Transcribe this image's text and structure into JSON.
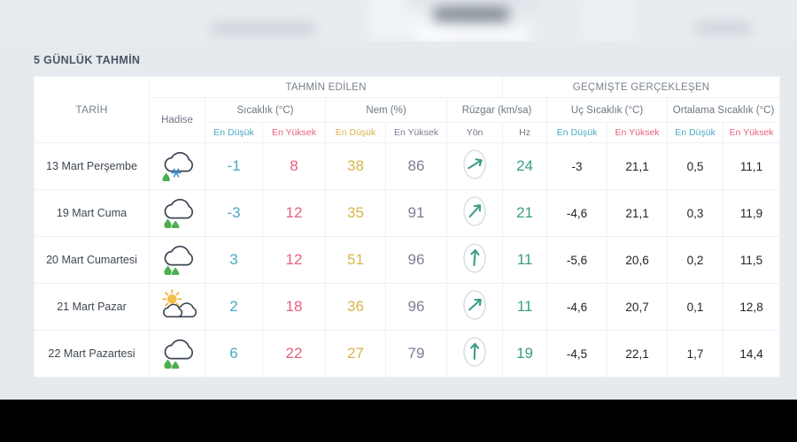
{
  "panel": {
    "title": "5 GÜNLÜK TAHMİN"
  },
  "colors": {
    "temp_low": "#49a9c4",
    "temp_high": "#e8607f",
    "humidity_low": "#d7b54a",
    "humidity_high": "#7a7f96",
    "wind_speed": "#3a9d88",
    "historic": "#1f2328",
    "page_bg": "#e6eaee",
    "table_bg": "#ffffff",
    "border": "#eef2f5",
    "title": "#4a5664"
  },
  "table": {
    "groups": {
      "date": "TARİH",
      "forecast": "TAHMİN EDİLEN",
      "historic": "GEÇMİŞTE GERÇEKLEŞEN"
    },
    "subgroups": {
      "event": "Hadise",
      "temperature": "Sıcaklık (°C)",
      "humidity": "Nem (%)",
      "wind": "Rüzgar (km/sa)",
      "extreme_temp": "Uç Sıcaklık (°C)",
      "average_temp": "Ortalama Sıcaklık (°C)"
    },
    "labels": {
      "temp_low": "En Düşük",
      "temp_high": "En Yüksek",
      "hum_low": "En Düşük",
      "hum_high": "En Yüksek",
      "wind_dir": "Yön",
      "wind_speed": "Hz",
      "ext_low": "En Düşük",
      "ext_high": "En Yüksek",
      "avg_low": "En Düşük",
      "avg_high": "En Yüksek"
    },
    "rows": [
      {
        "date": "13 Mart Perşembe",
        "icon": "cloud-rain-snow-icon",
        "temp_low": "-1",
        "temp_high": "8",
        "hum_low": "38",
        "hum_high": "86",
        "wind_dir_icon": "arrow-northeast-icon",
        "wind_dir_deg": 58,
        "wind_speed": "24",
        "ext_low": "-3",
        "ext_high": "21,1",
        "avg_low": "0,5",
        "avg_high": "11,1"
      },
      {
        "date": "19 Mart Cuma",
        "icon": "cloud-rain-icon",
        "temp_low": "-3",
        "temp_high": "12",
        "hum_low": "35",
        "hum_high": "91",
        "wind_dir_icon": "arrow-northeast-icon",
        "wind_dir_deg": 42,
        "wind_speed": "21",
        "ext_low": "-4,6",
        "ext_high": "21,1",
        "avg_low": "0,3",
        "avg_high": "11,9"
      },
      {
        "date": "20 Mart Cumartesi",
        "icon": "cloud-rain-icon",
        "temp_low": "3",
        "temp_high": "12",
        "hum_low": "51",
        "hum_high": "96",
        "wind_dir_icon": "arrow-north-icon",
        "wind_dir_deg": 5,
        "wind_speed": "11",
        "ext_low": "-5,6",
        "ext_high": "20,6",
        "avg_low": "0,2",
        "avg_high": "11,5"
      },
      {
        "date": "21 Mart Pazar",
        "icon": "sun-cloud-icon",
        "temp_low": "2",
        "temp_high": "18",
        "hum_low": "36",
        "hum_high": "96",
        "wind_dir_icon": "arrow-northeast-icon",
        "wind_dir_deg": 48,
        "wind_speed": "11",
        "ext_low": "-4,6",
        "ext_high": "20,7",
        "avg_low": "0,1",
        "avg_high": "12,8"
      },
      {
        "date": "22 Mart Pazartesi",
        "icon": "cloud-rain-icon",
        "temp_low": "6",
        "temp_high": "22",
        "hum_low": "27",
        "hum_high": "79",
        "wind_dir_icon": "arrow-north-icon",
        "wind_dir_deg": 2,
        "wind_speed": "19",
        "ext_low": "-4,5",
        "ext_high": "22,1",
        "avg_low": "1,7",
        "avg_high": "14,4"
      }
    ]
  }
}
